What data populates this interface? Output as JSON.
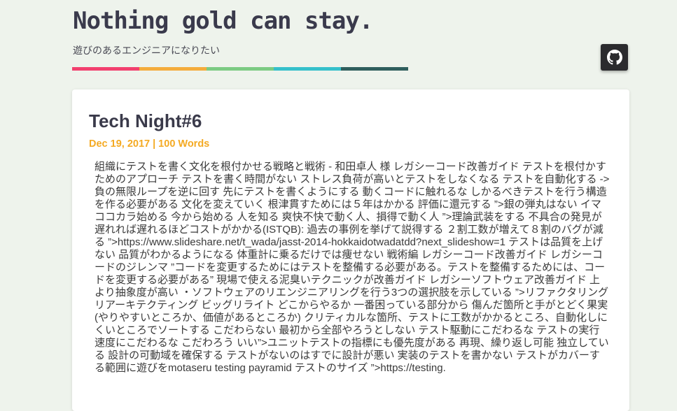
{
  "header": {
    "title": "Nothing gold can stay.",
    "subtitle": "遊びのあるエンジニアになりたい",
    "bar_colors": [
      "#f2406e",
      "#f4ac3c",
      "#7ccb83",
      "#35c0cb",
      "#2f5e5d"
    ]
  },
  "github_button": {
    "icon": "github-icon",
    "color": "#2b2b2e"
  },
  "post": {
    "title": "Tech Night#6",
    "meta": "Dec 19, 2017 | 100 Words",
    "body": "組織にテストを書く文化を根付かせる戦略と戦術 - 和田卓人 様 レガシーコード改善ガイド テストを根付かすためのアプローチ テストを書く時間がない ストレス負荷が高いとテストをしなくなる テストを自動化する -> 負の無限ループを逆に回す 先にテストを書くようにする 動くコードに触れるな しかるべきテストを行う構造を作る必要がある 文化を変えていく 根津貫すためには５年はかかる 評価に還元する ”>銀の弾丸はない イマココカラ始める 今から始める 人を知る 爽快不快で動く人、損得で動く人 ”>理論武装をする 不具合の発見が遅れれば遅れるほどコストがかかる(ISTQB): 過去の事例を挙げて説得する ２割工数が増えて８割のバグが減る ”>https://www.slideshare.net/t_wada/jasst-2014-hokkaidotwadatdd?next_slideshow=1 テストは品質を上げない 品質がわかるようになる 体重計に乗るだけでは痩せない 戦術編 レガシーコード改善ガイド レガシーコードのジレンマ ”コードを変更するためにはテストを整備する必要がある。テストを整備するためには、コードを変更する必要がある” 現場で使える泥臭いテクニックが改善ガイド レガシーソフトウェア改善ガイド 上より抽象度が高い ・ソフトウェアのリエンジニアリングを行う3つの選択肢を示している ”>リファクタリング リアーキテクティング ビッグリライト どこからやるか 一番困っている部分から 傷んだ箇所と手がとどく果実(やりやすいところか、価値があるところか) クリティカルな箇所、テストに工数がかかるところ、自動化しにくいところでソートする こだわらない 最初から全部やろうとしない テスト駆動にこだわるな テストの実行速度にこだわるな こだわろう いい”>ユニットテストの指標にも優先度がある 再現、繰り返し可能 独立している 設計の可動域を確保する テストがないのはすでに設計が悪い 実装のテストを書かない テストがカバーする範囲に遊びをmotaseru testing payramid テストのサイズ ”>https://testing."
  }
}
